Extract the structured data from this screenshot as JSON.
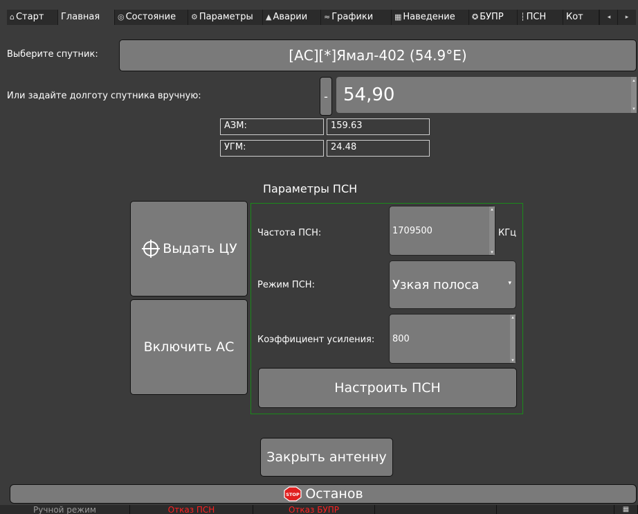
{
  "tabs": [
    {
      "icon": "⌂",
      "label": "Старт"
    },
    {
      "icon": "",
      "label": "Главная"
    },
    {
      "icon": "◎",
      "label": "Состояние"
    },
    {
      "icon": "⚙",
      "label": "Параметры"
    },
    {
      "icon": "▲",
      "label": "Аварии"
    },
    {
      "icon": "≈",
      "label": "Графики"
    },
    {
      "icon": "▦",
      "label": "Наведение"
    },
    {
      "icon": "✪",
      "label": "БУПР"
    },
    {
      "icon": "┆",
      "label": "ПСН"
    },
    {
      "icon": "",
      "label": "Кот"
    }
  ],
  "tab_nav": {
    "prev": "◂",
    "next": "▸"
  },
  "satellite": {
    "label": "Выберите спутник:",
    "selected": "[АС][*]Ямал-402 (54.9°E)"
  },
  "longitude": {
    "label": "Или задайте долготу спутника вручную:",
    "sign_button": "-",
    "value": "54,90"
  },
  "angles": {
    "azm_label": "АЗМ:",
    "azm_value": "159.63",
    "ugm_label": "УГМ:",
    "ugm_value": "24.48"
  },
  "psn": {
    "title": "Параметры ПСН",
    "freq_label": "Частота ПСН:",
    "freq_value": "1709500",
    "freq_unit": "КГц",
    "mode_label": "Режим ПСН:",
    "mode_value": "Узкая полоса",
    "gain_label": "Коэффициент усиления:",
    "gain_value": "800",
    "configure_button": "Настроить ПСН"
  },
  "actions": {
    "target_button": "Выдать ЦУ",
    "enable_button": "Включить АС",
    "close_antenna_button": "Закрыть антенну",
    "stop_button": "Останов",
    "stop_icon_text": "STOP"
  },
  "status": [
    {
      "text": "Ручной режим",
      "color": "#9a9a9a"
    },
    {
      "text": "Отказ ПСН",
      "color": "#ff2020"
    },
    {
      "text": "Отказ БУПР",
      "color": "#ff2020"
    },
    {
      "text": "",
      "color": "#ffffff"
    },
    {
      "text": "",
      "color": "#ffffff"
    },
    {
      "text": "",
      "color": "#ffffff"
    }
  ],
  "colors": {
    "background": "#3b3b3b",
    "button": "#7a7a7a",
    "group_border": "#1a8a1a",
    "alarm": "#ff2020"
  }
}
